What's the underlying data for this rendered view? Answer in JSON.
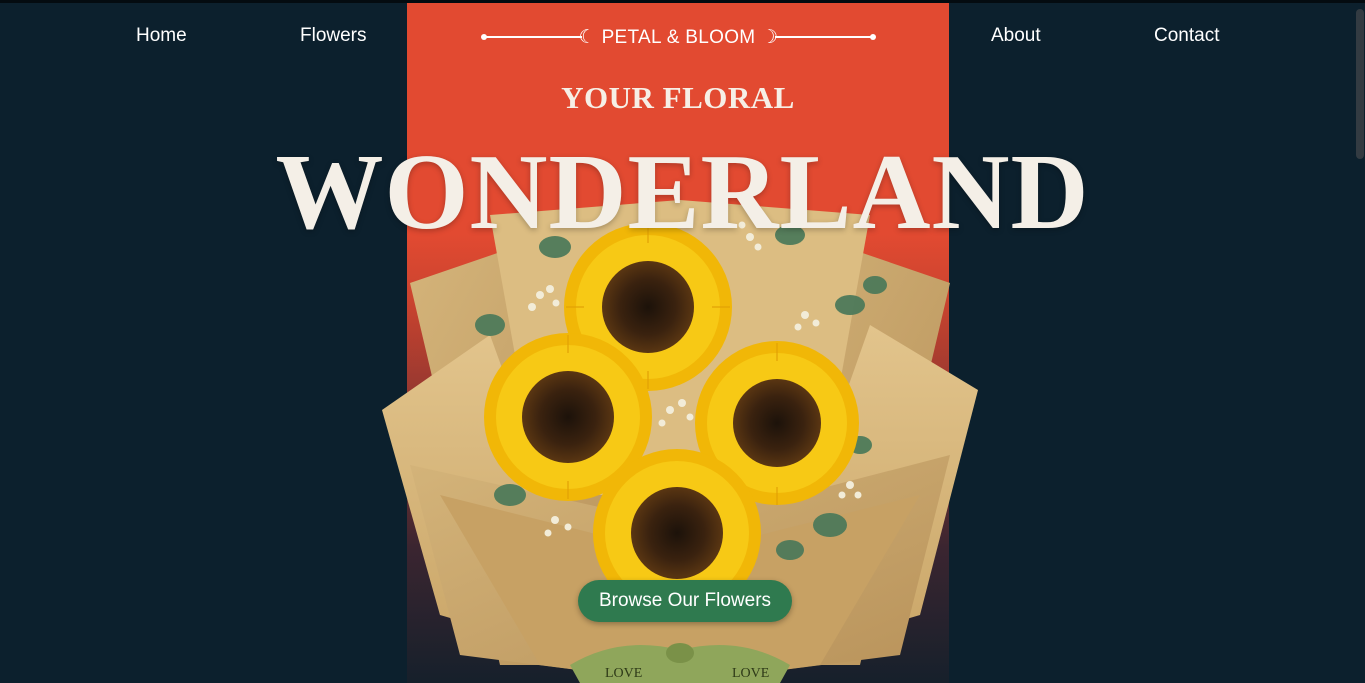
{
  "nav": {
    "home": "Home",
    "flowers": "Flowers",
    "about": "About",
    "contact": "Contact"
  },
  "brand": {
    "name": "☾ PETAL & BLOOM ☽"
  },
  "hero": {
    "eyebrow": "YOUR FLORAL",
    "headline": "WONDERLAND",
    "cta": "Browse Our Flowers",
    "ribbon_text": "LOVE"
  },
  "colors": {
    "page_background": "#0c202d",
    "panel_accent": "#e24a31",
    "cta_background": "#2f7a4f",
    "headline_text": "#f4efe7"
  },
  "icons": {
    "brand_left": "crescent-moon-icon",
    "brand_right": "crescent-moon-icon"
  }
}
